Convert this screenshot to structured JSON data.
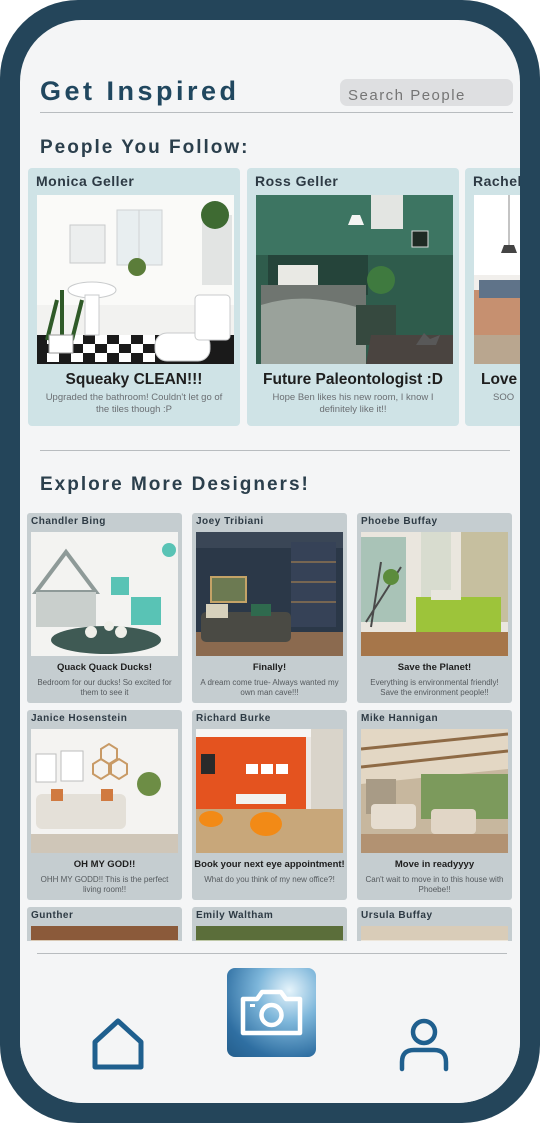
{
  "header": {
    "title": "Get Inspired",
    "search_placeholder": "Search People"
  },
  "following": {
    "title": "People You Follow:",
    "cards": [
      {
        "name": "Monica Geller",
        "headline": "Squeaky CLEAN!!!",
        "description": "Upgraded the bathroom! Couldn't let go of the tiles though :P"
      },
      {
        "name": "Ross Geller",
        "headline": "Future Paleontologist :D",
        "description": "Hope Ben likes his new room, I know I definitely like it!!"
      },
      {
        "name": "Rachel",
        "headline": "Love",
        "description": "SOO"
      }
    ]
  },
  "explore": {
    "title": "Explore More Designers!",
    "cards": [
      {
        "name": "Chandler Bing",
        "headline": "Quack Quack Ducks!",
        "description": "Bedroom for our ducks! So excited for them to see it"
      },
      {
        "name": "Joey Tribiani",
        "headline": "Finally!",
        "description": "A dream come true- Always wanted my own man cave!!!"
      },
      {
        "name": "Phoebe Buffay",
        "headline": "Save the Planet!",
        "description": "Everything is environmental friendly! Save the environment people!!"
      },
      {
        "name": "Janice Hosenstein",
        "headline": "OH MY GOD!!",
        "description": "OHH MY GODD!! This is the perfect living room!!"
      },
      {
        "name": "Richard Burke",
        "headline": "Book your next eye appointment!",
        "description": "What do you think of my new office?!"
      },
      {
        "name": "Mike Hannigan",
        "headline": "Move in readyyyy",
        "description": "Can't wait to move in to this house with Phoebe!!"
      },
      {
        "name": "Gunther",
        "headline": "",
        "description": ""
      },
      {
        "name": "Emily Waltham",
        "headline": "",
        "description": ""
      },
      {
        "name": "Ursula Buffay",
        "headline": "",
        "description": ""
      }
    ]
  },
  "nav": {
    "items": [
      "home-icon",
      "camera-icon",
      "profile-icon"
    ]
  },
  "colors": {
    "frame": "#24455a",
    "title": "#20475f",
    "follow_card": "#cfe3e6",
    "grid_card": "#c5cdd0",
    "accent": "#2f6fa2"
  }
}
